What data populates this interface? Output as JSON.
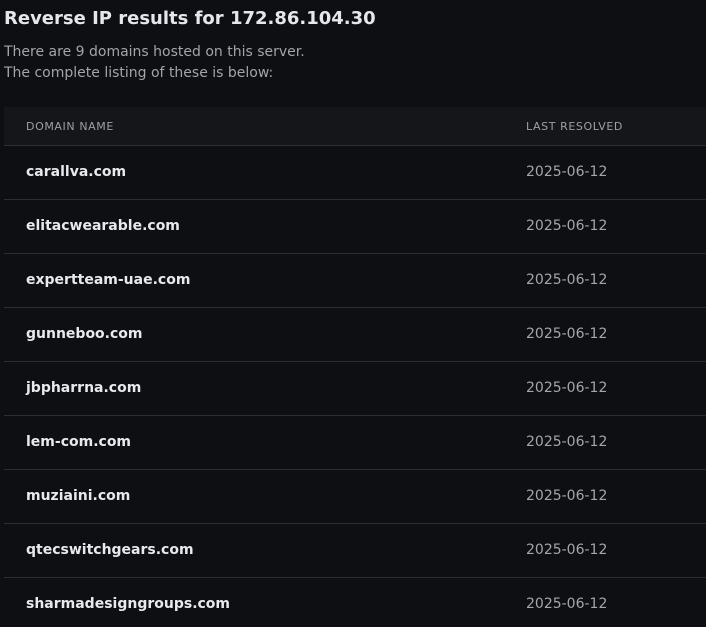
{
  "header": {
    "title": "Reverse IP results for 172.86.104.30",
    "intro_line1": "There are 9 domains hosted on this server.",
    "intro_line2": "The complete listing of these is below:"
  },
  "table": {
    "columns": [
      "DOMAIN NAME",
      "LAST RESOLVED"
    ],
    "rows": [
      {
        "domain": "carallva.com",
        "last_resolved": "2025-06-12"
      },
      {
        "domain": "elitacwearable.com",
        "last_resolved": "2025-06-12"
      },
      {
        "domain": "expertteam-uae.com",
        "last_resolved": "2025-06-12"
      },
      {
        "domain": "gunneboo.com",
        "last_resolved": "2025-06-12"
      },
      {
        "domain": "jbpharrna.com",
        "last_resolved": "2025-06-12"
      },
      {
        "domain": "lem-com.com",
        "last_resolved": "2025-06-12"
      },
      {
        "domain": "muziaini.com",
        "last_resolved": "2025-06-12"
      },
      {
        "domain": "qtecswitchgears.com",
        "last_resolved": "2025-06-12"
      },
      {
        "domain": "sharmadesigngroups.com",
        "last_resolved": "2025-06-12"
      }
    ]
  }
}
